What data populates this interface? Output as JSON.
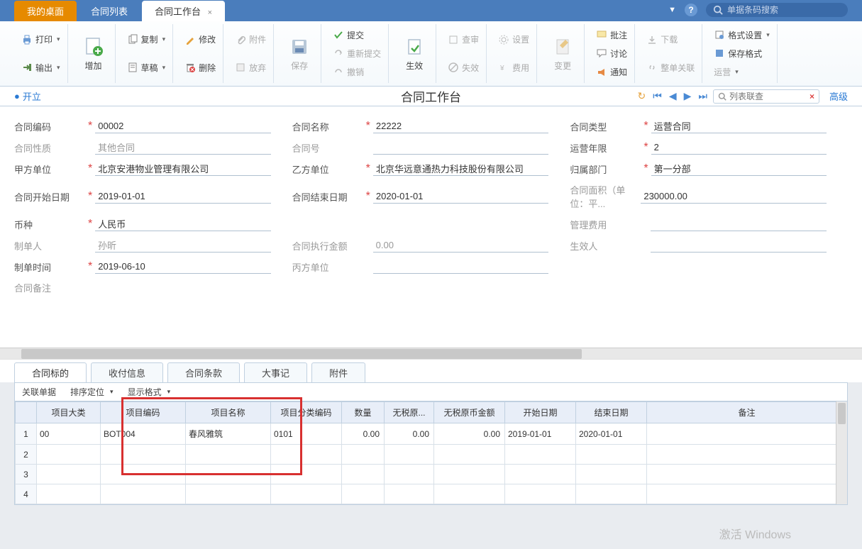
{
  "topTabs": {
    "t0": "我的桌面",
    "t1": "合同列表",
    "t2": "合同工作台"
  },
  "topSearch": {
    "placeholder": "单据条码搜索"
  },
  "ribbon": {
    "print": "打印",
    "export": "输出",
    "add": "增加",
    "copy": "复制",
    "draft": "草稿",
    "modify": "修改",
    "delete": "删除",
    "attach": "附件",
    "discard": "放弃",
    "save": "保存",
    "submit": "提交",
    "resubmit": "重新提交",
    "revoke": "撤销",
    "effect": "生效",
    "audit": "查审",
    "invalid": "失效",
    "setting": "设置",
    "cost": "费用",
    "change": "变更",
    "batch": "批注",
    "discuss": "讨论",
    "notify": "通知",
    "download": "下载",
    "related": "整单关联",
    "format": "格式设置",
    "saveformat": "保存格式",
    "operate": "运营"
  },
  "status": {
    "state": "开立",
    "title": "合同工作台",
    "listSearch": "列表联查",
    "adv": "高级"
  },
  "form": {
    "labels": {
      "code": "合同编码",
      "name": "合同名称",
      "type": "合同类型",
      "nature": "合同性质",
      "no": "合同号",
      "years": "运营年限",
      "partyA": "甲方单位",
      "partyB": "乙方单位",
      "dept": "归属部门",
      "start": "合同开始日期",
      "end": "合同结束日期",
      "area": "合同面积（单位：平...",
      "currency": "币种",
      "mgmtFee": "管理费用",
      "maker": "制单人",
      "execAmt": "合同执行金额",
      "effector": "生效人",
      "makeTime": "制单时间",
      "partyC": "丙方单位",
      "remark": "合同备注"
    },
    "values": {
      "code": "00002",
      "name": "22222",
      "type": "运营合同",
      "nature": "其他合同",
      "no": "",
      "years": "2",
      "partyA": "北京安港物业管理有限公司",
      "partyB": "北京华远意通热力科技股份有限公司",
      "dept": "第一分部",
      "start": "2019-01-01",
      "end": "2020-01-01",
      "area": "230000.00",
      "currency": "人民币",
      "mgmtFee": "",
      "maker": "孙昕",
      "execAmt": "0.00",
      "effector": "",
      "makeTime": "2019-06-10",
      "partyC": "",
      "remark": ""
    }
  },
  "detailTabs": {
    "t0": "合同标的",
    "t1": "收付信息",
    "t2": "合同条款",
    "t3": "大事记",
    "t4": "附件"
  },
  "detailToolbar": {
    "related": "关联单据",
    "sort": "排序定位",
    "display": "显示格式"
  },
  "grid": {
    "headers": {
      "cat": "项目大类",
      "code": "项目编码",
      "name": "项目名称",
      "clsCode": "项目分类编码",
      "qty": "数量",
      "noTaxOrig": "无税原...",
      "noTaxOrigAmt": "无税原币金额",
      "start": "开始日期",
      "end": "结束日期",
      "remark": "备注"
    },
    "rows": [
      {
        "n": "1",
        "cat": "00",
        "code": "BOT004",
        "name": "春风雅筑",
        "clsCode": "0101",
        "qty": "0.00",
        "noTaxOrig": "0.00",
        "noTaxOrigAmt": "0.00",
        "start": "2019-01-01",
        "end": "2020-01-01",
        "remark": ""
      },
      {
        "n": "2"
      },
      {
        "n": "3"
      },
      {
        "n": "4"
      }
    ]
  },
  "watermark": "激活 Windows"
}
